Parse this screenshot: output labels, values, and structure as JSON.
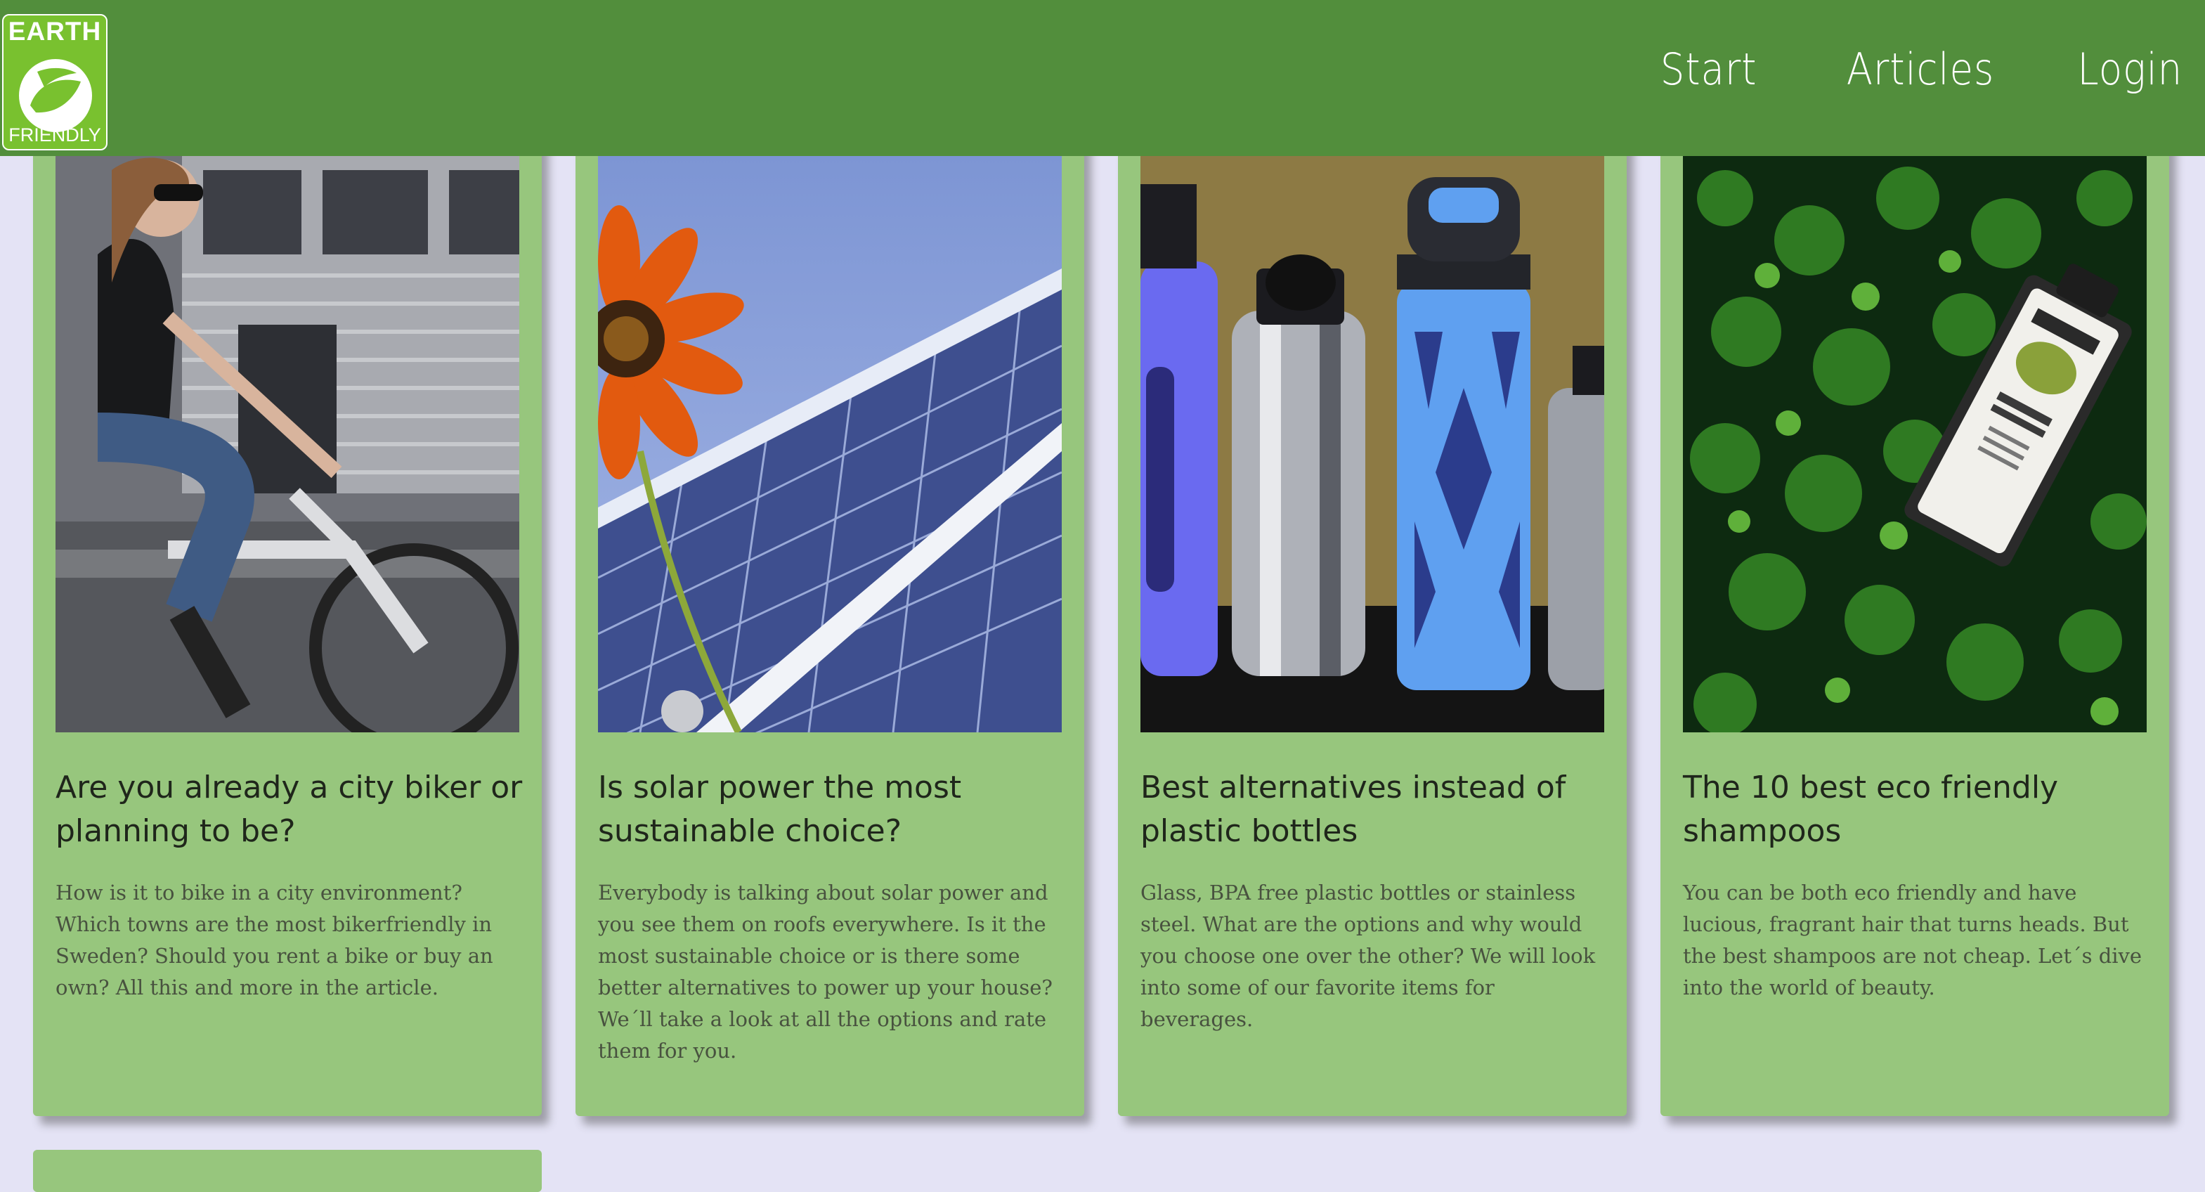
{
  "header": {
    "logo": {
      "top": "EARTH",
      "bottom": "FRIENDLY"
    },
    "nav": [
      {
        "label": "Start"
      },
      {
        "label": "Articles"
      },
      {
        "label": "Login"
      }
    ],
    "colors": {
      "header": "#528e3c",
      "card": "#97c67d",
      "page": "#e4e3f5",
      "logo": "#79c12f"
    }
  },
  "articles": [
    {
      "image": "woman-cycling-city-photo",
      "title": "Are you already a city biker or planning to be?",
      "excerpt": "How is it to bike in a city environment? Which towns are the most bikerfriendly in Sweden? Should you rent a bike or buy an own? All this and more in the article."
    },
    {
      "image": "sunflower-solar-panel-photo",
      "title": "Is solar power the most sustainable choice?",
      "excerpt": "Everybody is talking about solar power and you see them on roofs everywhere. Is it the most sustainable choice or is there some better alternatives to power up your house? We´ll take a look at all the options and rate them for you."
    },
    {
      "image": "reusable-bottles-photo",
      "title": "Best alternatives instead of plastic bottles",
      "excerpt": "Glass, BPA free plastic bottles or stainless steel. What are the options and why would you choose one over the other? We will look into some of our favorite items for beverages."
    },
    {
      "image": "herbal-shampoo-leaves-photo",
      "title": "The 10 best eco friendly shampoos",
      "excerpt": "You can be both eco friendly and have lucious, fragrant hair that turns heads. But the best shampoos are not cheap. Let´s dive into the world of beauty."
    }
  ]
}
